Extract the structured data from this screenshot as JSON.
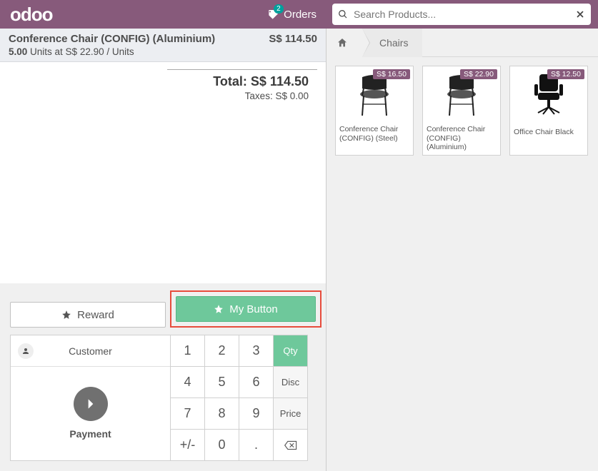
{
  "header": {
    "logo_text": "odoo",
    "orders_label": "Orders",
    "orders_count": "2",
    "search_placeholder": "Search Products..."
  },
  "order": {
    "line": {
      "name": "Conference Chair (CONFIG) (Aluminium)",
      "qty": "5.00",
      "unit_text": " Units at S$ 22.90 / Units",
      "price": "S$ 114.50"
    },
    "total_label": "Total: ",
    "total_value": "S$ 114.50",
    "taxes_label": "Taxes: ",
    "taxes_value": "S$ 0.00"
  },
  "buttons": {
    "reward": "Reward",
    "mybutton": "My Button",
    "customer": "Customer",
    "payment": "Payment"
  },
  "keypad": {
    "k1": "1",
    "k2": "2",
    "k3": "3",
    "qty": "Qty",
    "k4": "4",
    "k5": "5",
    "k6": "6",
    "disc": "Disc",
    "k7": "7",
    "k8": "8",
    "k9": "9",
    "price": "Price",
    "pm": "+/-",
    "k0": "0",
    "dot": "."
  },
  "breadcrumb": {
    "chairs": "Chairs"
  },
  "products": [
    {
      "name": "Conference Chair (CONFIG) (Steel)",
      "price": "S$ 16.50",
      "type": "conf"
    },
    {
      "name": "Conference Chair (CONFIG) (Aluminium)",
      "price": "S$ 22.90",
      "type": "conf"
    },
    {
      "name": "Office Chair Black",
      "price": "S$ 12.50",
      "type": "office"
    }
  ]
}
